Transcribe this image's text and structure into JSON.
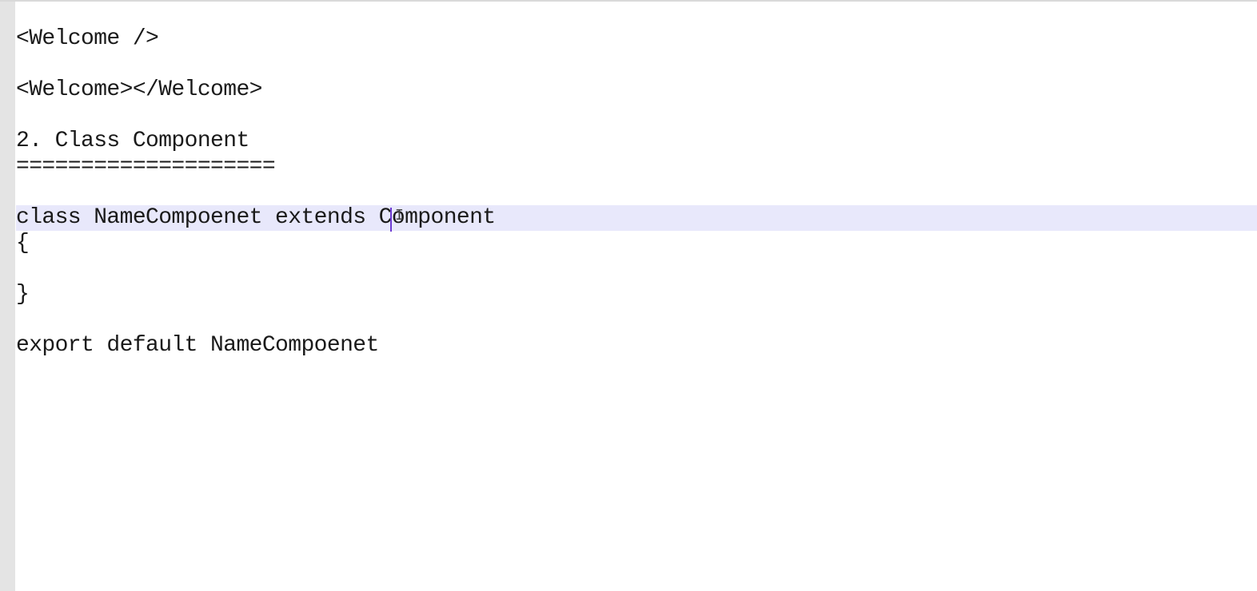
{
  "editor": {
    "lines": [
      "<Welcome />",
      "",
      "<Welcome></Welcome>",
      "",
      "2. Class Component",
      "====================",
      "",
      "class NameCompoenet extends Component",
      "{",
      "",
      "}",
      "",
      "export default NameCompoenet"
    ],
    "current_line_index": 7,
    "colors": {
      "text": "#1a1a1a",
      "current_line_highlight": "#e8e8fb",
      "caret": "#6d3ad1",
      "gutter": "#e4e4e4"
    }
  }
}
